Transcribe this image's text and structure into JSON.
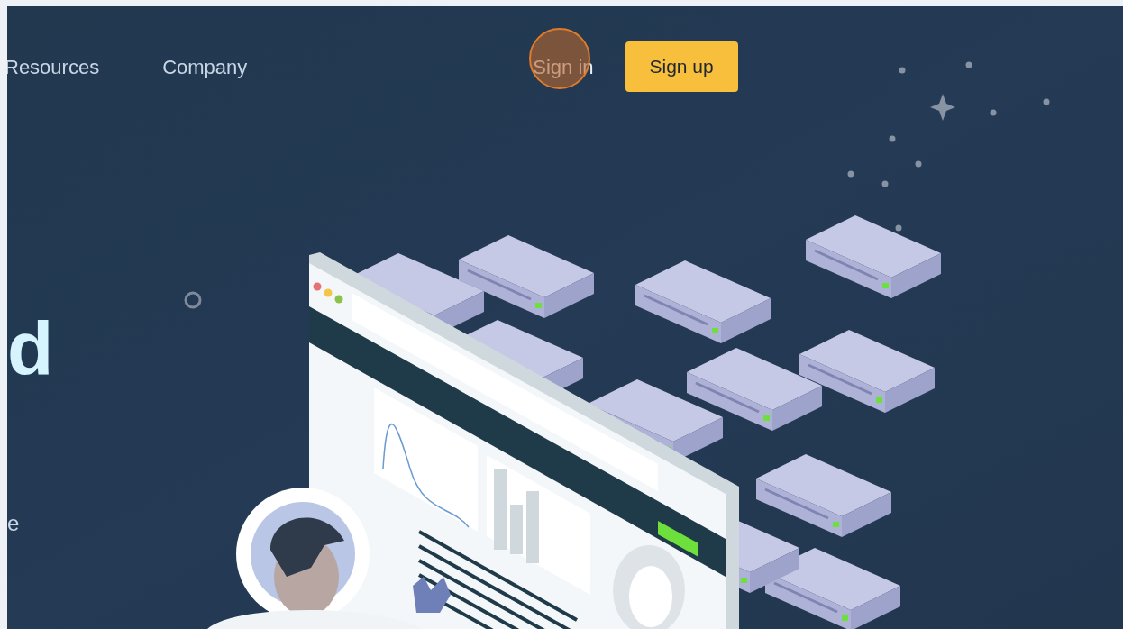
{
  "nav": {
    "links": [
      {
        "label": "Resources"
      },
      {
        "label": "Company"
      }
    ],
    "sign_in": "Sign in",
    "sign_up": "Sign up"
  },
  "hero": {
    "heading": "d",
    "text": "e"
  }
}
